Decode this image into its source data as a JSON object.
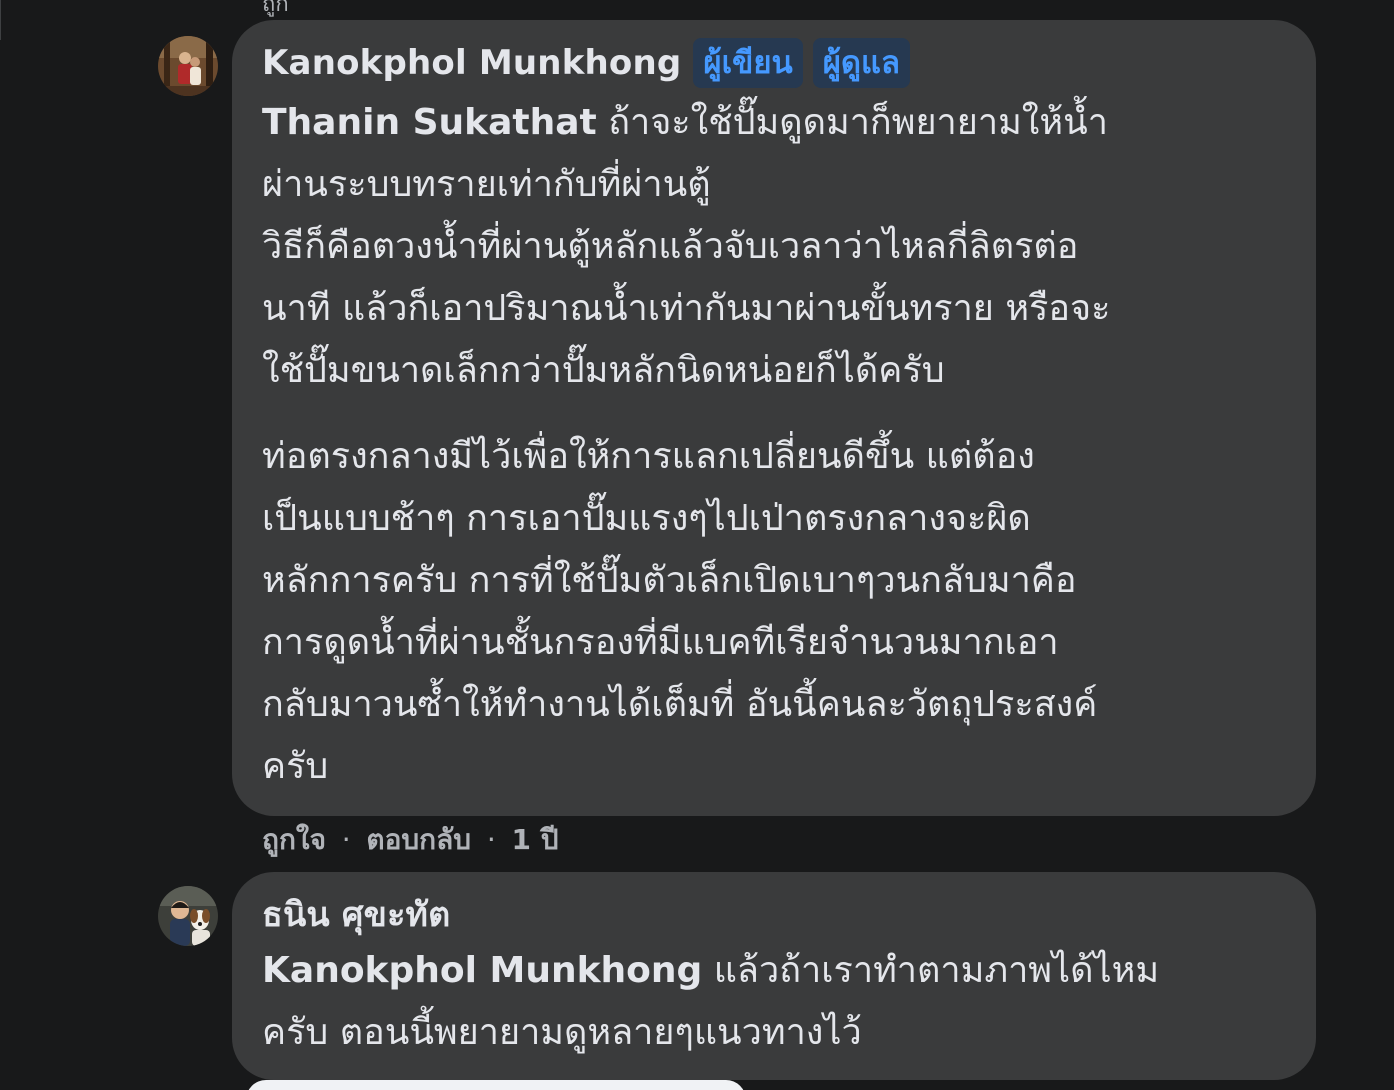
{
  "thread": {
    "top_crop_text": "ถูก"
  },
  "comment1": {
    "author": "Kanokphol Munkhong",
    "badges": [
      "ผู้เขียน",
      "ผู้ดูแล"
    ],
    "mention": "Thanin Sukathat",
    "paragraph1_lines": [
      " ถ้าจะใช้ปั๊มดูดมาก็พยายามให้น้ำ",
      "ผ่านระบบทรายเท่ากับที่ผ่านตู้",
      "วิธีก็คือตวงน้ำที่ผ่านตู้หลักแล้วจับเวลาว่าไหลกี่ลิตรต่อ",
      "นาที แล้วก็เอาปริมาณน้ำเท่ากันมาผ่านขั้นทราย หรือจะ",
      "ใช้ปั๊มขนาดเล็กกว่าปั๊มหลักนิดหน่อยก็ได้ครับ"
    ],
    "paragraph2_lines": [
      "ท่อตรงกลางมีไว้เพื่อให้การแลกเปลี่ยนดีขึ้น แต่ต้อง",
      "เป็นแบบช้าๆ การเอาปั๊มแรงๆไปเป่าตรงกลางจะผิด",
      "หลักการครับ การที่ใช้ปั๊มตัวเล็กเปิดเบาๆวนกลับมาคือ",
      "การดูดน้ำที่ผ่านชั้นกรองที่มีแบคทีเรียจำนวนมากเอา",
      "กลับมาวนซ้ำให้ทำงานได้เต็มที่ อันนี้คนละวัตถุประสงค์",
      "ครับ"
    ],
    "actions": {
      "like": "ถูกใจ",
      "reply": "ตอบกลับ",
      "separator": "·",
      "time": "1 ปี"
    }
  },
  "comment2": {
    "author": "ธนิน ศุขะทัต",
    "mention": "Kanokphol Munkhong",
    "lines": [
      " แล้วถ้าเราทำตามภาพได้ไหม",
      "ครับ ตอนนี้พยายามดูหลายๆแนวทางไว้"
    ]
  },
  "colors": {
    "background": "#18191a",
    "bubble": "#3a3b3c",
    "text": "#e4e6eb",
    "secondary_text": "#b0b3b8",
    "badge_bg": "#263951",
    "badge_text": "#4599ff"
  }
}
